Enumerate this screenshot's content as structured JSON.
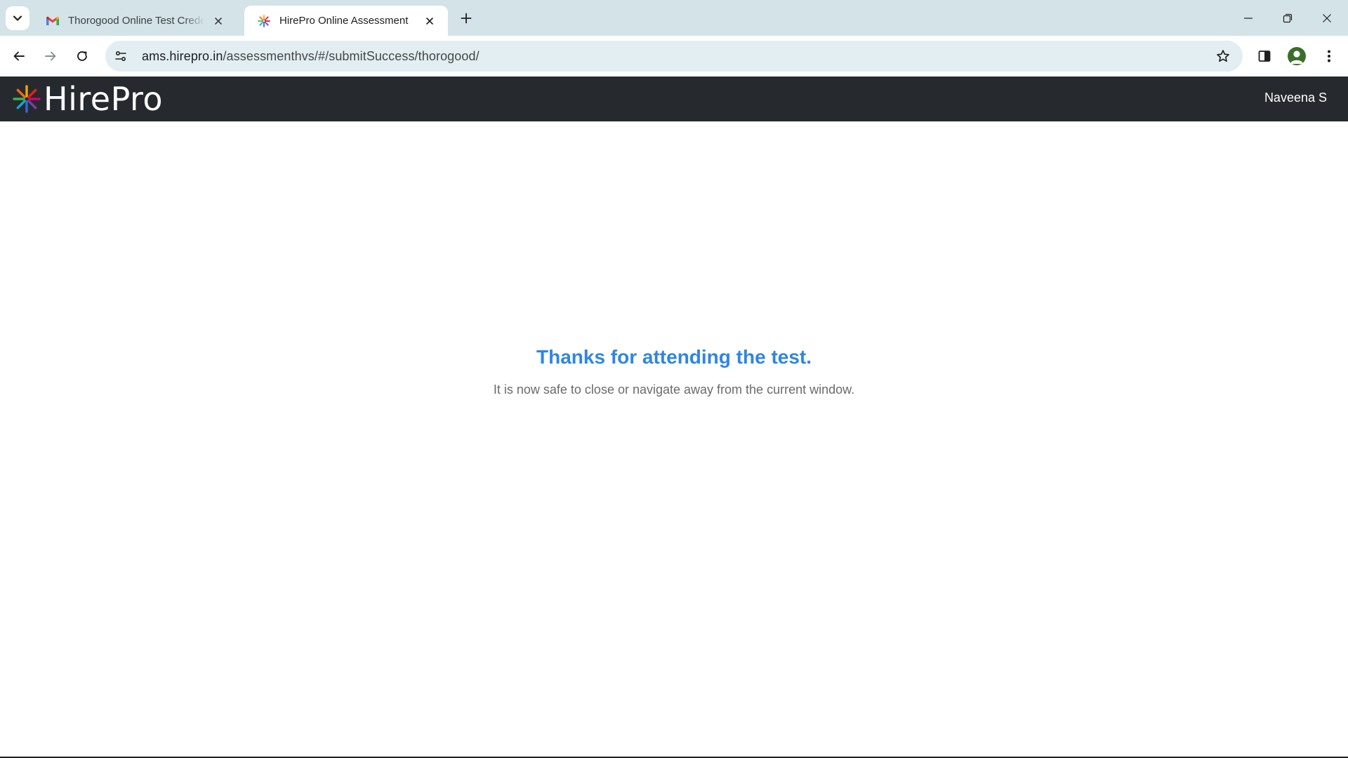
{
  "browser": {
    "tabs": [
      {
        "title": "Thorogood Online Test Credentials",
        "favicon": "gmail-icon",
        "active": false
      },
      {
        "title": "HirePro Online Assessment",
        "favicon": "hirepro-icon",
        "active": true
      }
    ],
    "address_bar": {
      "host": "ams.hirepro.in",
      "path": "/assessmenthvs/#/submitSuccess/thorogood/"
    }
  },
  "header": {
    "logo_text": "HirePro",
    "user_name": "Naveena S",
    "background": "#262a2e"
  },
  "main": {
    "title": "Thanks for attending the test.",
    "subtitle": "It is now safe to close or navigate away from the current window.",
    "title_color": "#2f86e4"
  }
}
